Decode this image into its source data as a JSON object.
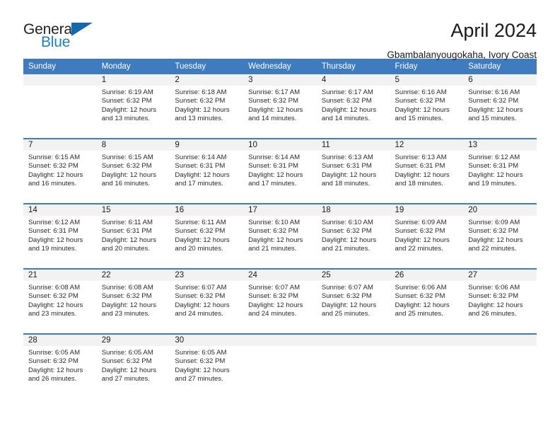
{
  "brand": {
    "name_part1": "General",
    "name_part2": "Blue",
    "logo_icon": "triangle-flag-icon",
    "accent_color": "#1d7fc3"
  },
  "header": {
    "title": "April 2024",
    "subtitle": "Gbambalanyougokaha, Ivory Coast"
  },
  "colors": {
    "header_row_bg": "#3e7cbf",
    "header_row_text": "#ffffff",
    "daynum_band_bg": "#f2f2f2",
    "row_divider": "#3e7cbf"
  },
  "weekday_headers": [
    "Sunday",
    "Monday",
    "Tuesday",
    "Wednesday",
    "Thursday",
    "Friday",
    "Saturday"
  ],
  "weeks": [
    [
      {
        "day": "",
        "sunrise": "",
        "sunset": "",
        "daylight_line1": "",
        "daylight_line2": ""
      },
      {
        "day": "1",
        "sunrise": "Sunrise: 6:19 AM",
        "sunset": "Sunset: 6:32 PM",
        "daylight_line1": "Daylight: 12 hours",
        "daylight_line2": "and 13 minutes."
      },
      {
        "day": "2",
        "sunrise": "Sunrise: 6:18 AM",
        "sunset": "Sunset: 6:32 PM",
        "daylight_line1": "Daylight: 12 hours",
        "daylight_line2": "and 13 minutes."
      },
      {
        "day": "3",
        "sunrise": "Sunrise: 6:17 AM",
        "sunset": "Sunset: 6:32 PM",
        "daylight_line1": "Daylight: 12 hours",
        "daylight_line2": "and 14 minutes."
      },
      {
        "day": "4",
        "sunrise": "Sunrise: 6:17 AM",
        "sunset": "Sunset: 6:32 PM",
        "daylight_line1": "Daylight: 12 hours",
        "daylight_line2": "and 14 minutes."
      },
      {
        "day": "5",
        "sunrise": "Sunrise: 6:16 AM",
        "sunset": "Sunset: 6:32 PM",
        "daylight_line1": "Daylight: 12 hours",
        "daylight_line2": "and 15 minutes."
      },
      {
        "day": "6",
        "sunrise": "Sunrise: 6:16 AM",
        "sunset": "Sunset: 6:32 PM",
        "daylight_line1": "Daylight: 12 hours",
        "daylight_line2": "and 15 minutes."
      }
    ],
    [
      {
        "day": "7",
        "sunrise": "Sunrise: 6:15 AM",
        "sunset": "Sunset: 6:32 PM",
        "daylight_line1": "Daylight: 12 hours",
        "daylight_line2": "and 16 minutes."
      },
      {
        "day": "8",
        "sunrise": "Sunrise: 6:15 AM",
        "sunset": "Sunset: 6:32 PM",
        "daylight_line1": "Daylight: 12 hours",
        "daylight_line2": "and 16 minutes."
      },
      {
        "day": "9",
        "sunrise": "Sunrise: 6:14 AM",
        "sunset": "Sunset: 6:31 PM",
        "daylight_line1": "Daylight: 12 hours",
        "daylight_line2": "and 17 minutes."
      },
      {
        "day": "10",
        "sunrise": "Sunrise: 6:14 AM",
        "sunset": "Sunset: 6:31 PM",
        "daylight_line1": "Daylight: 12 hours",
        "daylight_line2": "and 17 minutes."
      },
      {
        "day": "11",
        "sunrise": "Sunrise: 6:13 AM",
        "sunset": "Sunset: 6:31 PM",
        "daylight_line1": "Daylight: 12 hours",
        "daylight_line2": "and 18 minutes."
      },
      {
        "day": "12",
        "sunrise": "Sunrise: 6:13 AM",
        "sunset": "Sunset: 6:31 PM",
        "daylight_line1": "Daylight: 12 hours",
        "daylight_line2": "and 18 minutes."
      },
      {
        "day": "13",
        "sunrise": "Sunrise: 6:12 AM",
        "sunset": "Sunset: 6:31 PM",
        "daylight_line1": "Daylight: 12 hours",
        "daylight_line2": "and 19 minutes."
      }
    ],
    [
      {
        "day": "14",
        "sunrise": "Sunrise: 6:12 AM",
        "sunset": "Sunset: 6:31 PM",
        "daylight_line1": "Daylight: 12 hours",
        "daylight_line2": "and 19 minutes."
      },
      {
        "day": "15",
        "sunrise": "Sunrise: 6:11 AM",
        "sunset": "Sunset: 6:31 PM",
        "daylight_line1": "Daylight: 12 hours",
        "daylight_line2": "and 20 minutes."
      },
      {
        "day": "16",
        "sunrise": "Sunrise: 6:11 AM",
        "sunset": "Sunset: 6:32 PM",
        "daylight_line1": "Daylight: 12 hours",
        "daylight_line2": "and 20 minutes."
      },
      {
        "day": "17",
        "sunrise": "Sunrise: 6:10 AM",
        "sunset": "Sunset: 6:32 PM",
        "daylight_line1": "Daylight: 12 hours",
        "daylight_line2": "and 21 minutes."
      },
      {
        "day": "18",
        "sunrise": "Sunrise: 6:10 AM",
        "sunset": "Sunset: 6:32 PM",
        "daylight_line1": "Daylight: 12 hours",
        "daylight_line2": "and 21 minutes."
      },
      {
        "day": "19",
        "sunrise": "Sunrise: 6:09 AM",
        "sunset": "Sunset: 6:32 PM",
        "daylight_line1": "Daylight: 12 hours",
        "daylight_line2": "and 22 minutes."
      },
      {
        "day": "20",
        "sunrise": "Sunrise: 6:09 AM",
        "sunset": "Sunset: 6:32 PM",
        "daylight_line1": "Daylight: 12 hours",
        "daylight_line2": "and 22 minutes."
      }
    ],
    [
      {
        "day": "21",
        "sunrise": "Sunrise: 6:08 AM",
        "sunset": "Sunset: 6:32 PM",
        "daylight_line1": "Daylight: 12 hours",
        "daylight_line2": "and 23 minutes."
      },
      {
        "day": "22",
        "sunrise": "Sunrise: 6:08 AM",
        "sunset": "Sunset: 6:32 PM",
        "daylight_line1": "Daylight: 12 hours",
        "daylight_line2": "and 23 minutes."
      },
      {
        "day": "23",
        "sunrise": "Sunrise: 6:07 AM",
        "sunset": "Sunset: 6:32 PM",
        "daylight_line1": "Daylight: 12 hours",
        "daylight_line2": "and 24 minutes."
      },
      {
        "day": "24",
        "sunrise": "Sunrise: 6:07 AM",
        "sunset": "Sunset: 6:32 PM",
        "daylight_line1": "Daylight: 12 hours",
        "daylight_line2": "and 24 minutes."
      },
      {
        "day": "25",
        "sunrise": "Sunrise: 6:07 AM",
        "sunset": "Sunset: 6:32 PM",
        "daylight_line1": "Daylight: 12 hours",
        "daylight_line2": "and 25 minutes."
      },
      {
        "day": "26",
        "sunrise": "Sunrise: 6:06 AM",
        "sunset": "Sunset: 6:32 PM",
        "daylight_line1": "Daylight: 12 hours",
        "daylight_line2": "and 25 minutes."
      },
      {
        "day": "27",
        "sunrise": "Sunrise: 6:06 AM",
        "sunset": "Sunset: 6:32 PM",
        "daylight_line1": "Daylight: 12 hours",
        "daylight_line2": "and 26 minutes."
      }
    ],
    [
      {
        "day": "28",
        "sunrise": "Sunrise: 6:05 AM",
        "sunset": "Sunset: 6:32 PM",
        "daylight_line1": "Daylight: 12 hours",
        "daylight_line2": "and 26 minutes."
      },
      {
        "day": "29",
        "sunrise": "Sunrise: 6:05 AM",
        "sunset": "Sunset: 6:32 PM",
        "daylight_line1": "Daylight: 12 hours",
        "daylight_line2": "and 27 minutes."
      },
      {
        "day": "30",
        "sunrise": "Sunrise: 6:05 AM",
        "sunset": "Sunset: 6:32 PM",
        "daylight_line1": "Daylight: 12 hours",
        "daylight_line2": "and 27 minutes."
      },
      {
        "day": "",
        "sunrise": "",
        "sunset": "",
        "daylight_line1": "",
        "daylight_line2": ""
      },
      {
        "day": "",
        "sunrise": "",
        "sunset": "",
        "daylight_line1": "",
        "daylight_line2": ""
      },
      {
        "day": "",
        "sunrise": "",
        "sunset": "",
        "daylight_line1": "",
        "daylight_line2": ""
      },
      {
        "day": "",
        "sunrise": "",
        "sunset": "",
        "daylight_line1": "",
        "daylight_line2": ""
      }
    ]
  ]
}
